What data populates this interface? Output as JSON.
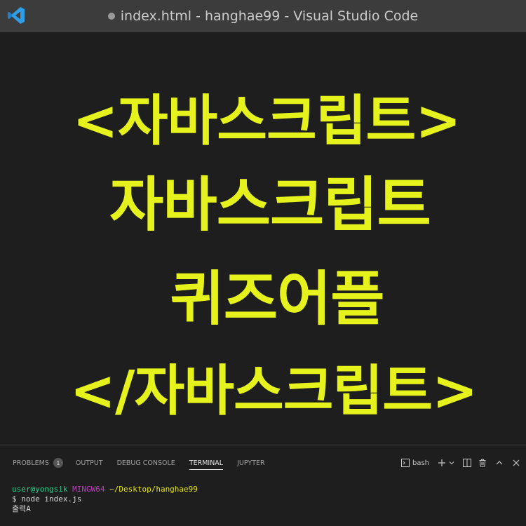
{
  "window": {
    "title": "index.html - hanghae99 - Visual Studio Code",
    "modified_indicator": true
  },
  "editor": {
    "banner_lines": [
      "<자바스크립트>",
      "자바스크립트",
      "퀴즈어플",
      "</자바스크립트>"
    ],
    "text_color": "#e6f21c",
    "background": "#1e1e1e"
  },
  "panel": {
    "tabs": [
      {
        "label": "PROBLEMS",
        "badge": "1"
      },
      {
        "label": "OUTPUT"
      },
      {
        "label": "DEBUG CONSOLE"
      },
      {
        "label": "TERMINAL",
        "active": true
      },
      {
        "label": "JUPYTER"
      }
    ],
    "actions": {
      "shell_label": "bash",
      "icons": [
        "terminal-icon",
        "plus-icon",
        "chevron-down-icon",
        "split-icon",
        "trash-icon",
        "chevron-up-icon",
        "close-icon"
      ]
    }
  },
  "terminal": {
    "prompt_user": "user@yongsik",
    "prompt_host": "MINGW64",
    "prompt_path": "~/Desktop/hanghae99",
    "command": "$ node index.js",
    "output": "출력A"
  }
}
